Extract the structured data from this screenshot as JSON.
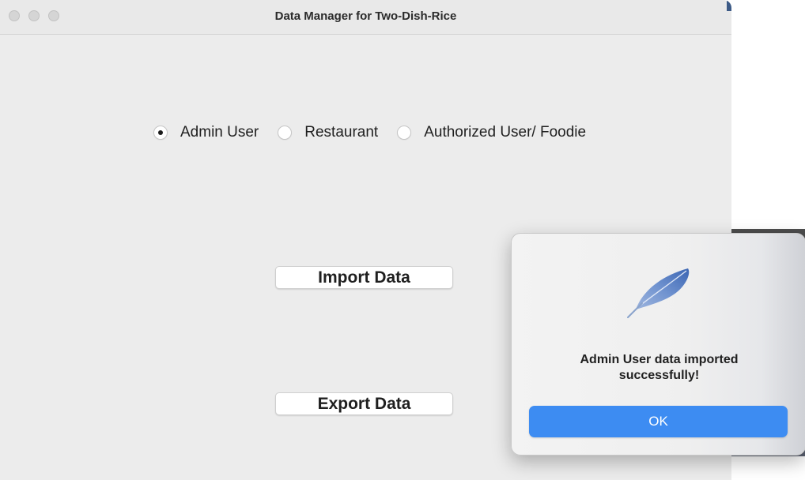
{
  "window": {
    "title": "Data Manager for Two-Dish-Rice"
  },
  "user_type": {
    "options": [
      {
        "label": "Admin User",
        "selected": true
      },
      {
        "label": "Restaurant",
        "selected": false
      },
      {
        "label": "Authorized User/ Foodie",
        "selected": false
      }
    ]
  },
  "actions": {
    "import_label": "Import Data",
    "export_label": "Export Data"
  },
  "dialog": {
    "icon": "feather-icon",
    "message_line1": "Admin User data imported",
    "message_line2": "successfully!",
    "ok_label": "OK",
    "accent": "#3d8cf2"
  }
}
